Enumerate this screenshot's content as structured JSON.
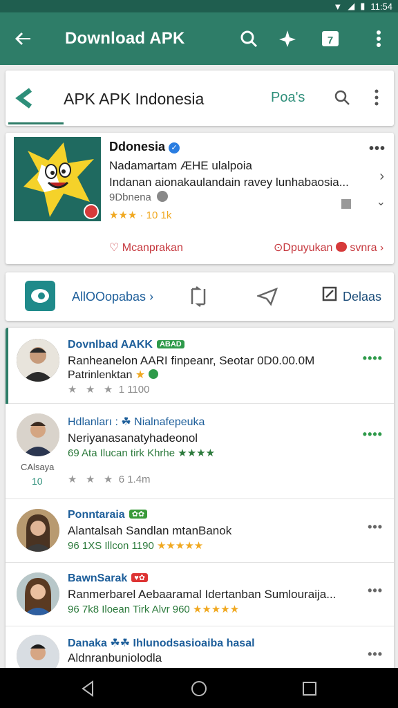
{
  "status_bar": {
    "time": "11:54"
  },
  "app_bar": {
    "title": "Download APK",
    "badge": "7"
  },
  "search_card": {
    "title": "APK APK Indonesia",
    "posts_label": "Poa's"
  },
  "info_card": {
    "name": "Ddonesia",
    "line1": "Nadamartam ÆHE ulalpoia",
    "line2": "Indanan aionakaulandain ravey lunhabaosia...",
    "meta": "9Dbnena",
    "rating": "★★★ · 10 1k",
    "link_left": "Mcanprakan",
    "link_right": "Dpuyukan",
    "link_right2": "svnra"
  },
  "action_bar": {
    "label": "AllOOopabas",
    "details": "Delaas"
  },
  "list": [
    {
      "name": "Dovnlbad AAKK",
      "badge": "ABAD",
      "text": "Ranheanelon AARI finpeanr, Seotar 0D0.00.0M",
      "sub": "Patrinlenktan",
      "stars": "1 1100"
    },
    {
      "name": "Hdlanları : ☘ Nialnafepeuka",
      "text": "Neriyanasanatyhadeonol",
      "sub": "69 Ata Ilucan tirk Khrhe ★★★★",
      "stars": "6 1.4m",
      "left_caption": "CAlsaya",
      "left_count": "10"
    },
    {
      "name": "Ponntaraia",
      "text": "Alantalsah Sandlan mtanBanok",
      "sub": "96 1XS Illcon 1190"
    },
    {
      "name": "BawnSarak",
      "text": "Ranmerbarel Aebaaramal Idertanban Sumlouraija...",
      "sub": "96 7k8 Iloean Tirk Alvr 960"
    },
    {
      "name": "Danaka ☘☘ Ihlunodsasioaiba hasal",
      "text": "Aldnranbuniolodla",
      "sub": ""
    }
  ],
  "colors": {
    "app_bar": "#2e7d68",
    "status_bar": "#1f5e4f",
    "accent_teal": "#2e8f7a",
    "link_red": "#c6393f",
    "name_blue": "#1d5e9a",
    "more_green": "#2e9a4a"
  },
  "icons": {
    "back": "arrow-left-icon",
    "search": "search-icon",
    "flight": "airplane-icon",
    "calendar": "calendar-icon",
    "more": "more-vert-icon"
  }
}
